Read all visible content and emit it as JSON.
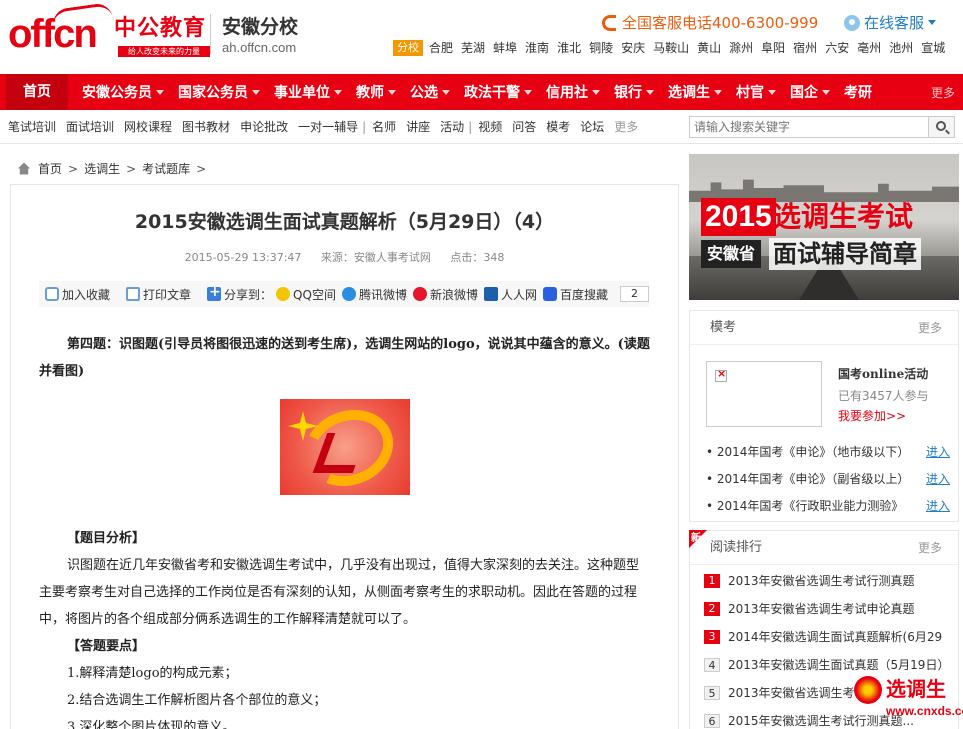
{
  "header": {
    "logo_text": "offcn",
    "logo_cn": "中公教育",
    "logo_slogan": "给人改变未来的力量",
    "branch_name": "安徽分校",
    "branch_url": "ah.offcn.com",
    "hotline": "全国客服电话400-6300-999",
    "online_service": "在线客服",
    "city_badge": "分校",
    "cities": [
      "合肥",
      "芜湖",
      "蚌埠",
      "淮南",
      "淮北",
      "铜陵",
      "安庆",
      "马鞍山",
      "黄山",
      "滁州",
      "阜阳",
      "宿州",
      "六安",
      "亳州",
      "池州",
      "宣城"
    ]
  },
  "mainnav": {
    "home": "首页",
    "items": [
      {
        "label": "安徽公务员",
        "dropdown": true
      },
      {
        "label": "国家公务员",
        "dropdown": true
      },
      {
        "label": "事业单位",
        "dropdown": true
      },
      {
        "label": "教师",
        "dropdown": true
      },
      {
        "label": "公选",
        "dropdown": true
      },
      {
        "label": "政法干警",
        "dropdown": true
      },
      {
        "label": "信用社",
        "dropdown": true
      },
      {
        "label": "银行",
        "dropdown": true
      },
      {
        "label": "选调生",
        "dropdown": true
      },
      {
        "label": "村官",
        "dropdown": true
      },
      {
        "label": "国企",
        "dropdown": true
      },
      {
        "label": "考研",
        "dropdown": false
      }
    ],
    "more": "更多"
  },
  "subnav": {
    "items": [
      "笔试培训",
      "面试培训",
      "网校课程",
      "图书教材",
      "申论批改",
      "一对一辅导",
      "|",
      "名师",
      "讲座",
      "活动",
      "|",
      "视频",
      "问答",
      "模考",
      "论坛",
      "更多"
    ],
    "search_placeholder": "请输入搜索关键字"
  },
  "breadcrumb": {
    "items": [
      "首页",
      "选调生",
      "考试题库"
    ]
  },
  "article": {
    "title": "2015安徽选调生面试真题解析（5月29日）（4）",
    "date": "2015-05-29 13:37:47",
    "source": "来源：安徽人事考试网",
    "views": "点击：348",
    "share": {
      "favorite": "加入收藏",
      "print": "打印文章",
      "share_to": "分享到：",
      "qq": "QQ空间",
      "tencent": "腾讯微博",
      "sina": "新浪微博",
      "renren": "人人网",
      "baidu": "百度搜藏",
      "count": "2"
    },
    "question": "第四题：识图题(引导员将图很迅速的送到考生席)，选调生网站的logo，说说其中蕴含的意义。(读题并看图)",
    "analysis_head": "【题目分析】",
    "analysis": "识图题在近几年安徽省考和安徽选调生考试中，几乎没有出现过，值得大家深刻的去关注。这种题型主要考察考生对自己选择的工作岗位是否有深刻的认知，从侧面考察考生的求职动机。因此在答题的过程中，将图片的各个组成部分俩系选调生的工作解释清楚就可以了。",
    "points_head": "【答题要点】",
    "points": [
      "1.解释清楚logo的构成元素；",
      "2.结合选调生工作解析图片各个部位的意义；",
      "3.深化整个图片体现的意义。"
    ]
  },
  "banner": {
    "year": "2015",
    "title1": "选调生考试",
    "province": "安徽省",
    "title2": "面试辅导简章"
  },
  "mock_panel": {
    "title": "模考",
    "more": "更多",
    "event_title": "国考online活动",
    "event_count": "已有3457人参与",
    "event_join": "我要参加>>",
    "rows": [
      {
        "text": "• 2014年国考《申论》（地市级以下）",
        "action": "进入"
      },
      {
        "text": "• 2014年国考《申论》（副省级以上）",
        "action": "进入"
      },
      {
        "text": "• 2014年国考《行政职业能力测验》",
        "action": "进入"
      }
    ]
  },
  "rank_panel": {
    "badge": "新",
    "title": "阅读排行",
    "more": "更多",
    "rows": [
      {
        "num": "1",
        "text": "2013年安徽省选调生考试行测真题"
      },
      {
        "num": "2",
        "text": "2013年安徽省选调生考试申论真题"
      },
      {
        "num": "3",
        "text": "2014年安徽选调生面试真题解析(6月29"
      },
      {
        "num": "4",
        "text": "2013年安徽选调生面试真题（5月19日）"
      },
      {
        "num": "5",
        "text": "2013年安徽省选调生考试..."
      },
      {
        "num": "6",
        "text": "2015年安徽选调生考试行测真题..."
      }
    ]
  },
  "watermark": {
    "text": "选调生",
    "url": "www.cnxds.com"
  }
}
